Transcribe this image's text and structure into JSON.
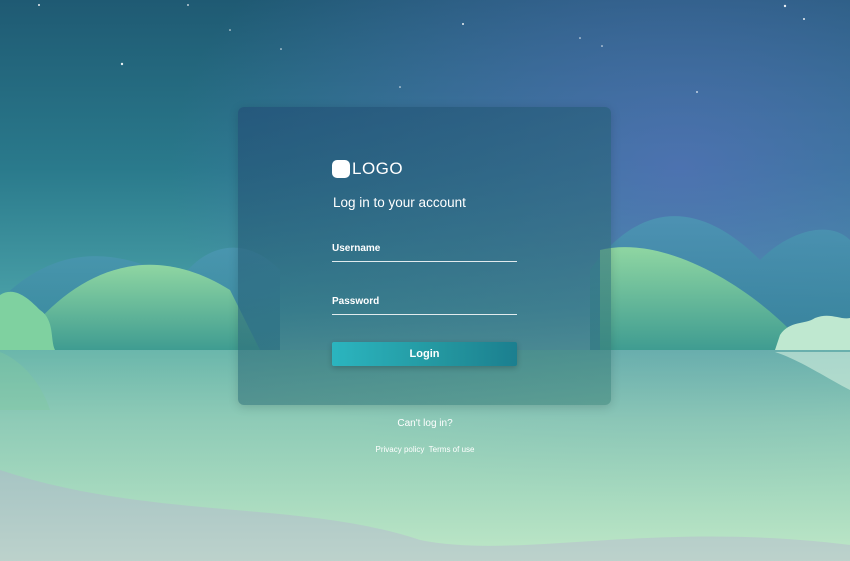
{
  "brand": {
    "logo_text": "LOGO"
  },
  "login": {
    "heading": "Log in to your account",
    "username_label": "Username",
    "password_label": "Password",
    "login_button": "Login"
  },
  "links": {
    "cant_login": "Can't log in?",
    "privacy_policy": "Privacy policy",
    "terms_of_use": "Terms of use"
  }
}
